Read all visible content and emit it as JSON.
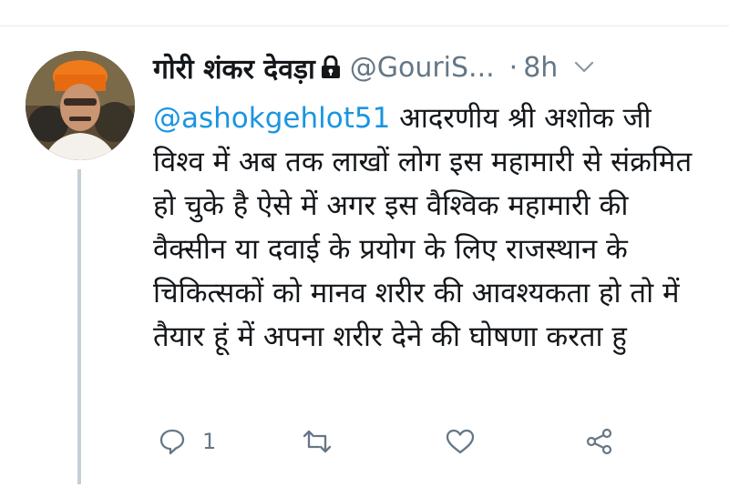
{
  "tweet": {
    "display_name": "गोरी शंकर देवड़ा",
    "handle": "@GouriS...",
    "separator": "·",
    "time": "8h",
    "mention": "@ashokgehlot51",
    "text": "आदरणीय श्री अशोक जी विश्व में अब तक लाखों लोग इस महामारी से संक्रमित हो चुके है ऐसे में अगर इस वैश्विक महामारी की वैक्सीन या दवाई के प्रयोग के लिए राजस्थान के चिकित्सकों  को मानव शरीर की आवश्यकता हो तो में तैयार हूं में अपना शरीर देने की घोषणा करता हु"
  },
  "actions": {
    "reply_icon": "reply-icon",
    "reply_count": "1",
    "retweet_icon": "retweet-icon",
    "like_icon": "heart-icon",
    "share_icon": "share-icon"
  },
  "colors": {
    "link": "#1b95e0",
    "secondary_text": "#657786",
    "icon": "#657786"
  }
}
